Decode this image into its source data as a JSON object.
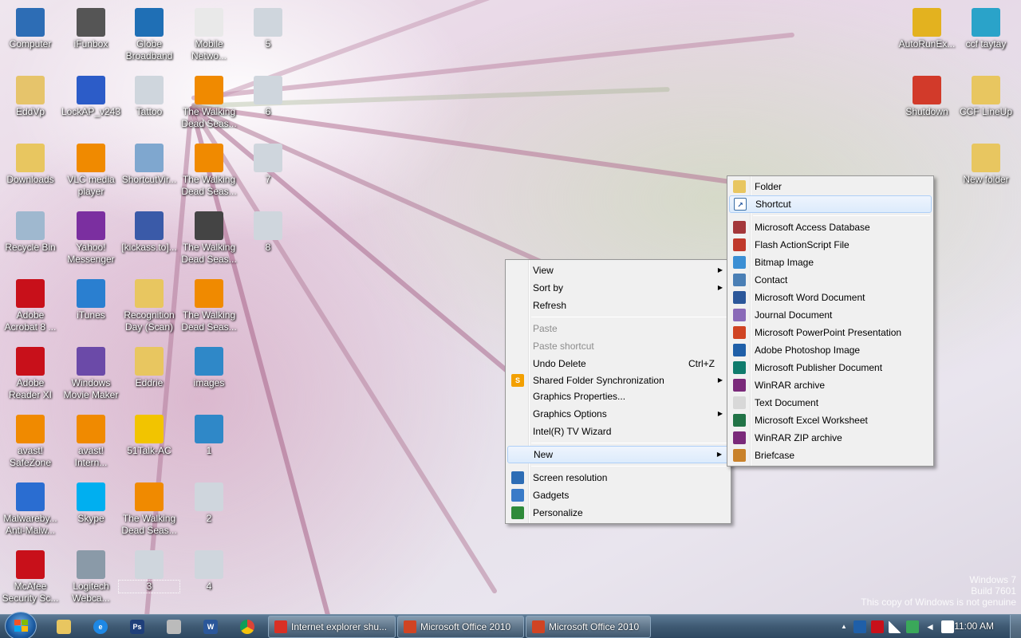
{
  "desktop": {
    "icons": [
      {
        "label": "Computer",
        "icon": "computer-icon",
        "color": "#2d6db5"
      },
      {
        "label": "iFunbox",
        "icon": "ifunbox-icon",
        "color": "#555555"
      },
      {
        "label": "Globe Broadband",
        "icon": "globe-icon",
        "color": "#1f6fb5"
      },
      {
        "label": "Mobile Netwo...",
        "icon": "document-icon",
        "color": "#e9e9e9"
      },
      {
        "label": "5",
        "icon": "image-file-icon",
        "color": "#cfd6dd"
      },
      {
        "label": "AutoRunEx...",
        "icon": "red-x-icon",
        "color": "#e3b21f"
      },
      {
        "label": "ccf taytay",
        "icon": "ccf-icon",
        "color": "#2aa3c9"
      },
      {
        "label": "EddVp",
        "icon": "user-folder-icon",
        "color": "#e6c46b"
      },
      {
        "label": "LockAP_v243",
        "icon": "key-icon",
        "color": "#2c5cc8"
      },
      {
        "label": "Tattoo",
        "icon": "image-file-icon",
        "color": "#cfd6dd"
      },
      {
        "label": "The Walking Dead Seas...",
        "icon": "vlc-icon",
        "color": "#f08a00"
      },
      {
        "label": "6",
        "icon": "image-file-icon",
        "color": "#cfd6dd"
      },
      {
        "label": "Shutdown",
        "icon": "power-icon",
        "color": "#d23a2a"
      },
      {
        "label": "CCF LineUp",
        "icon": "folder-icon",
        "color": "#e8c660"
      },
      {
        "label": "Downloads",
        "icon": "downloads-folder-icon",
        "color": "#e8c660"
      },
      {
        "label": "VLC media player",
        "icon": "vlc-icon",
        "color": "#f08a00"
      },
      {
        "label": "ShortcutVir...",
        "icon": "gear-icon",
        "color": "#7fa7cf"
      },
      {
        "label": "The Walking Dead Seas...",
        "icon": "vlc-icon",
        "color": "#f08a00"
      },
      {
        "label": "7",
        "icon": "image-file-icon",
        "color": "#cfd6dd"
      },
      {
        "label": "New folder",
        "icon": "folder-icon",
        "color": "#e8c660"
      },
      {
        "label": "Recycle Bin",
        "icon": "recycle-bin-icon",
        "color": "#9fb8cf"
      },
      {
        "label": "Yahoo! Messenger",
        "icon": "yahoo-messenger-icon",
        "color": "#7b2fa0"
      },
      {
        "label": "[kickass.to]...",
        "icon": "kickass-icon",
        "color": "#3a5aa8"
      },
      {
        "label": "The Walking Dead Seas...",
        "icon": "video-icon",
        "color": "#444444"
      },
      {
        "label": "8",
        "icon": "image-file-icon",
        "color": "#cfd6dd"
      },
      {
        "label": "Adobe Acrobat 8 ...",
        "icon": "acrobat-icon",
        "color": "#c8101a"
      },
      {
        "label": "iTunes",
        "icon": "itunes-icon",
        "color": "#2a7fd0"
      },
      {
        "label": "Recognition Day (Scan)",
        "icon": "folder-icon",
        "color": "#e8c660"
      },
      {
        "label": "The Walking Dead Seas...",
        "icon": "vlc-icon",
        "color": "#f08a00"
      },
      {
        "label": "Adobe Reader XI",
        "icon": "adobe-reader-icon",
        "color": "#c8101a"
      },
      {
        "label": "Windows Movie Maker",
        "icon": "movie-maker-icon",
        "color": "#6b4aa8"
      },
      {
        "label": "Eddrie",
        "icon": "folder-icon",
        "color": "#e8c660"
      },
      {
        "label": "images",
        "icon": "image-file-icon",
        "color": "#2f88c8"
      },
      {
        "label": "avast! SafeZone",
        "icon": "avast-safezone-icon",
        "color": "#f08a00"
      },
      {
        "label": "avast! Intern...",
        "icon": "avast-icon",
        "color": "#f08a00"
      },
      {
        "label": "51Talk-AC",
        "icon": "51talk-icon",
        "color": "#f2c400"
      },
      {
        "label": "1",
        "icon": "image-file-icon",
        "color": "#2f88c8"
      },
      {
        "label": "Malwareby... Anti-Malw...",
        "icon": "malwarebytes-icon",
        "color": "#2a6dd1"
      },
      {
        "label": "Skype",
        "icon": "skype-icon",
        "color": "#00aff0"
      },
      {
        "label": "The Walking Dead Seas...",
        "icon": "vlc-icon",
        "color": "#f08a00"
      },
      {
        "label": "2",
        "icon": "image-file-icon",
        "color": "#cfd6dd"
      },
      {
        "label": "McAfee Security Sc...",
        "icon": "mcafee-icon",
        "color": "#c8101a"
      },
      {
        "label": "Logitech Webca...",
        "icon": "webcam-icon",
        "color": "#8a9aa8"
      },
      {
        "label": "3",
        "icon": "image-file-icon",
        "color": "#cfd6dd"
      },
      {
        "label": "4",
        "icon": "image-file-icon",
        "color": "#cfd6dd"
      }
    ]
  },
  "context_menu": {
    "view": "View",
    "sort_by": "Sort by",
    "refresh": "Refresh",
    "paste": "Paste",
    "paste_shortcut": "Paste shortcut",
    "undo_delete": "Undo Delete",
    "undo_shortcut": "Ctrl+Z",
    "shared_folder_sync": "Shared Folder Synchronization",
    "graphics_properties": "Graphics Properties...",
    "graphics_options": "Graphics Options",
    "intel_tv_wizard": "Intel(R) TV Wizard",
    "new": "New",
    "screen_resolution": "Screen resolution",
    "gadgets": "Gadgets",
    "personalize": "Personalize"
  },
  "new_submenu": {
    "folder": "Folder",
    "shortcut": "Shortcut",
    "items": [
      {
        "label": "Microsoft Access Database",
        "icon": "access-icon",
        "color": "#a4373a"
      },
      {
        "label": "Flash ActionScript File",
        "icon": "flash-icon",
        "color": "#c0392b"
      },
      {
        "label": "Bitmap Image",
        "icon": "bitmap-icon",
        "color": "#3b8fd4"
      },
      {
        "label": "Contact",
        "icon": "contact-icon",
        "color": "#4a7fb5"
      },
      {
        "label": "Microsoft Word Document",
        "icon": "word-icon",
        "color": "#2b579a"
      },
      {
        "label": "Journal Document",
        "icon": "journal-icon",
        "color": "#8a6ab8"
      },
      {
        "label": "Microsoft PowerPoint Presentation",
        "icon": "powerpoint-icon",
        "color": "#d04423"
      },
      {
        "label": "Adobe Photoshop Image",
        "icon": "photoshop-icon",
        "color": "#1f5fa8"
      },
      {
        "label": "Microsoft Publisher Document",
        "icon": "publisher-icon",
        "color": "#0f7b6c"
      },
      {
        "label": "WinRAR archive",
        "icon": "winrar-icon",
        "color": "#7a2a7a"
      },
      {
        "label": "Text Document",
        "icon": "text-document-icon",
        "color": "#d8d8d8"
      },
      {
        "label": "Microsoft Excel Worksheet",
        "icon": "excel-icon",
        "color": "#217346"
      },
      {
        "label": "WinRAR ZIP archive",
        "icon": "winrar-zip-icon",
        "color": "#7a2a7a"
      },
      {
        "label": "Briefcase",
        "icon": "briefcase-icon",
        "color": "#c9822b"
      }
    ]
  },
  "taskbar": {
    "tasks": [
      {
        "label": "Internet explorer shu...",
        "icon": "chrome-icon",
        "color": "#d93025"
      },
      {
        "label": "Microsoft Office 2010",
        "icon": "office-installer-icon",
        "color": "#d04423"
      },
      {
        "label": "Microsoft Office 2010",
        "icon": "office-installer-icon",
        "color": "#d04423"
      }
    ],
    "clock": "11:00 AM"
  },
  "watermark": {
    "line1": "Windows 7",
    "line2": "Build 7601",
    "line3": "This copy of Windows is not genuine"
  }
}
